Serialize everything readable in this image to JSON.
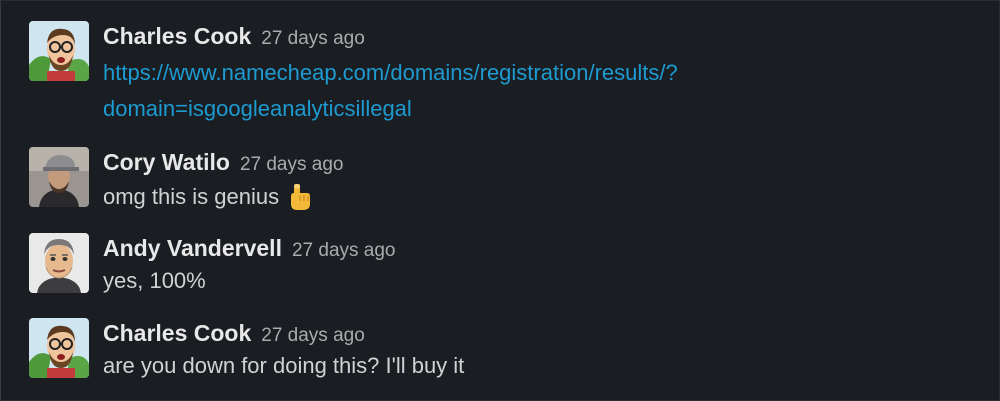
{
  "messages": [
    {
      "author": "Charles Cook",
      "time": "27 days ago",
      "avatar_icon": "cartoon-bearded-man-avatar",
      "link_line1": "https://www.namecheap.com/domains/registration/results/?",
      "link_line2": "domain=isgoogleanalyticsillegal"
    },
    {
      "author": "Cory Watilo",
      "time": "27 days ago",
      "avatar_icon": "man-in-cap-photo-avatar",
      "text": "omg this is genius",
      "emoji": "pointing-up-hand-emoji"
    },
    {
      "author": "Andy Vandervell",
      "time": "27 days ago",
      "avatar_icon": "cartoon-man-portrait-avatar",
      "text": "yes, 100%"
    },
    {
      "author": "Charles Cook",
      "time": "27 days ago",
      "avatar_icon": "cartoon-bearded-man-avatar",
      "text": "are you down for doing this? I'll buy it"
    }
  ],
  "colors": {
    "background": "#1a1d21",
    "link": "#1d9bd1",
    "author": "#e8e8e8",
    "timestamp": "#ababad",
    "body_text": "#d1d2d3"
  }
}
